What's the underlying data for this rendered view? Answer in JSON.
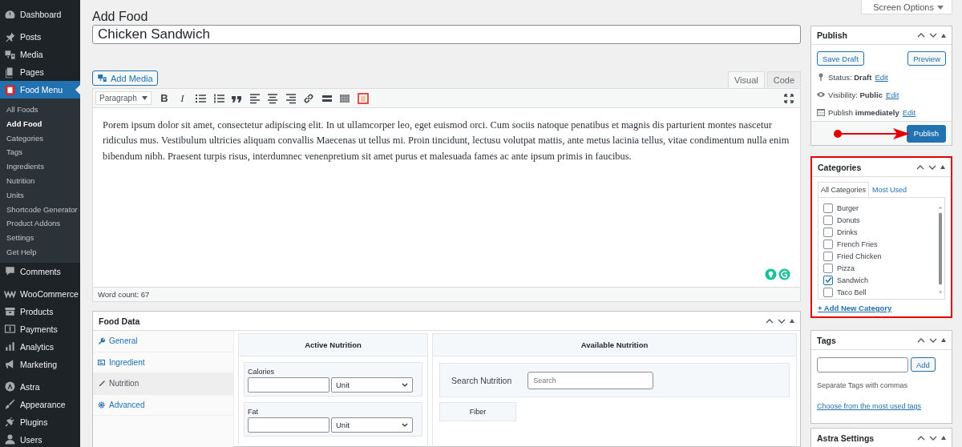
{
  "sidebar": {
    "groups": [
      [
        {
          "label": "Dashboard",
          "selected": false
        }
      ],
      [
        {
          "label": "Posts",
          "selected": false
        },
        {
          "label": "Media",
          "selected": false
        },
        {
          "label": "Pages",
          "selected": false
        },
        {
          "label": "Food Menu",
          "selected": true,
          "children": [
            {
              "label": "All Foods",
              "selected": false
            },
            {
              "label": "Add Food",
              "selected": true
            },
            {
              "label": "Categories",
              "selected": false
            },
            {
              "label": "Tags",
              "selected": false
            },
            {
              "label": "Ingredients",
              "selected": false
            },
            {
              "label": "Nutrition",
              "selected": false
            },
            {
              "label": "Units",
              "selected": false
            },
            {
              "label": "Shortcode Generator",
              "selected": false
            },
            {
              "label": "Product Addons",
              "selected": false
            },
            {
              "label": "Settings",
              "selected": false
            },
            {
              "label": "Get Help",
              "selected": false
            }
          ]
        },
        {
          "label": "Comments",
          "selected": false
        }
      ],
      [
        {
          "label": "WooCommerce",
          "selected": false
        },
        {
          "label": "Products",
          "selected": false
        },
        {
          "label": "Payments",
          "selected": false
        },
        {
          "label": "Analytics",
          "selected": false
        },
        {
          "label": "Marketing",
          "selected": false
        }
      ],
      [
        {
          "label": "Astra",
          "selected": false
        },
        {
          "label": "Appearance",
          "selected": false
        },
        {
          "label": "Plugins",
          "selected": false
        },
        {
          "label": "Users",
          "selected": false
        }
      ]
    ]
  },
  "screen_options": "Screen Options",
  "page_title": "Add Food",
  "title_field": {
    "value": "Chicken Sandwich"
  },
  "editor": {
    "add_media": "Add Media",
    "tabs": [
      {
        "label": "Visual",
        "selected": true
      },
      {
        "label": "Code",
        "selected": false
      }
    ],
    "format_select": "Paragraph",
    "toolbar": [
      {
        "kind": "bold",
        "label": "B"
      },
      {
        "kind": "italic",
        "label": "I"
      },
      {
        "kind": "bullets"
      },
      {
        "kind": "numbers"
      },
      {
        "kind": "quote"
      },
      {
        "kind": "align-left"
      },
      {
        "kind": "align-center"
      },
      {
        "kind": "align-right"
      },
      {
        "kind": "link"
      },
      {
        "kind": "more"
      },
      {
        "kind": "toolbar-toggle"
      },
      {
        "kind": "food-menu"
      }
    ],
    "content": "Porem ipsum dolor sit amet, consectetur adipiscing elit. In ut ullamcorper leo, eget euismod orci. Cum sociis natoque penatibus et magnis dis parturient montes nascetur ridiculus mus. Vestibulum ultricies aliquam convallis Maecenas ut tellus mi. Proin tincidunt, lectusu volutpat mattis, ante metus lacinia tellus, vitae condimentum nulla enim bibendum nibh. Praesent turpis risus, interdumnec venenpretium sit amet purus et malesuada fames ac ante ipsum primis in faucibus.",
    "word_count": "Word count: 67"
  },
  "food_data": {
    "title": "Food Data",
    "tabs": [
      {
        "label": "General",
        "selected": false
      },
      {
        "label": "Ingredient",
        "selected": false
      },
      {
        "label": "Nutrition",
        "selected": true
      },
      {
        "label": "Advanced",
        "selected": false
      }
    ],
    "active_nutrition": {
      "title": "Active Nutrition",
      "items": [
        {
          "label": "Calories",
          "unit": "Unit"
        },
        {
          "label": "Fat",
          "unit": "Unit"
        }
      ]
    },
    "available_nutrition": {
      "title": "Available Nutrition",
      "search": {
        "label": "Search Nutrition",
        "placeholder": "Search"
      },
      "items": [
        "Fiber"
      ]
    }
  },
  "publish": {
    "title": "Publish",
    "save_draft": "Save Draft",
    "preview": "Preview",
    "rows": [
      {
        "kind": "status",
        "text": "Status: **Draft**",
        "link": "Edit"
      },
      {
        "kind": "visibility",
        "text": "Visibility: **Public**",
        "link": "Edit"
      },
      {
        "kind": "schedule",
        "text": "Publish **immediately**",
        "link": "Edit"
      }
    ],
    "publish_button": "Publish",
    "pointer_arrow": true
  },
  "categories": {
    "title": "Categories",
    "highlighted": true,
    "tabs": [
      {
        "label": "All Categories",
        "selected": true
      },
      {
        "label": "Most Used",
        "selected": false
      }
    ],
    "items": [
      {
        "label": "Burger",
        "checked": false
      },
      {
        "label": "Donuts",
        "checked": false
      },
      {
        "label": "Drinks",
        "checked": false
      },
      {
        "label": "French Fries",
        "checked": false
      },
      {
        "label": "Fried Chicken",
        "checked": false
      },
      {
        "label": "Pizza",
        "checked": false
      },
      {
        "label": "Sandwich",
        "checked": true
      },
      {
        "label": "Taco Bell",
        "checked": false
      }
    ],
    "add_link": "+ Add New Category"
  },
  "tags": {
    "title": "Tags",
    "add_button": "Add",
    "hint": "Separate Tags with commas",
    "link": "Choose from the most used tags"
  },
  "astra_settings": {
    "title": "Astra Settings"
  }
}
